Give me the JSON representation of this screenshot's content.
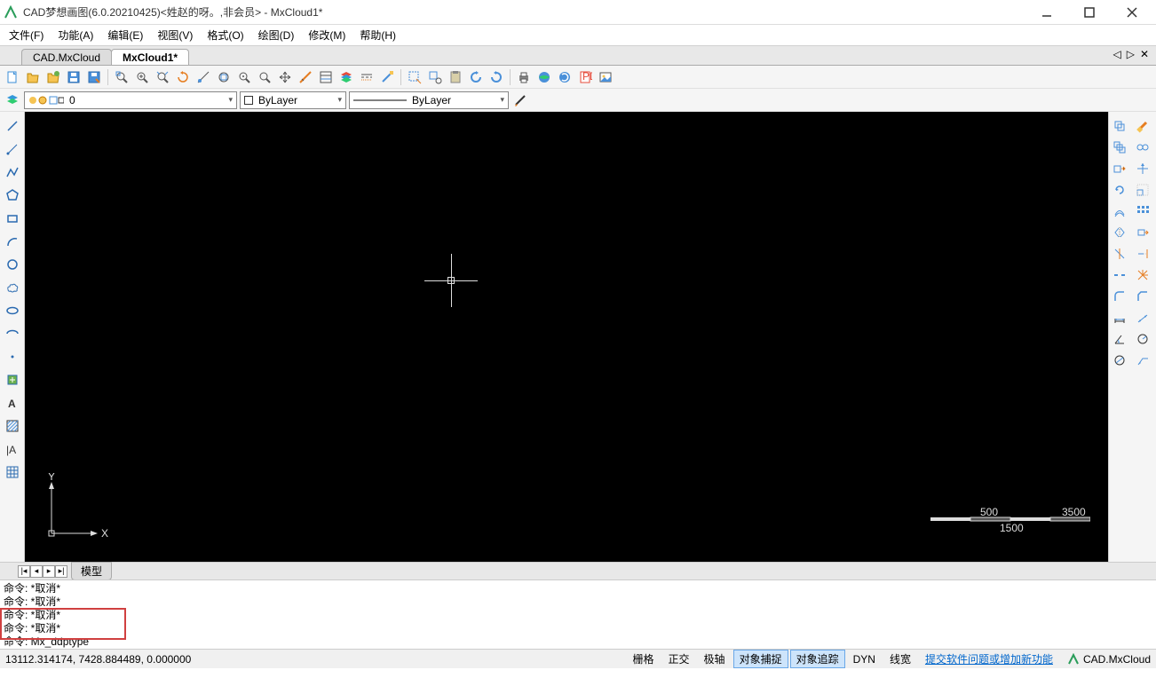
{
  "window": {
    "title": "CAD梦想画图(6.0.20210425)<姓赵的呀。,非会员> - MxCloud1*"
  },
  "menu": {
    "file": "文件(F)",
    "func": "功能(A)",
    "edit": "编辑(E)",
    "view": "视图(V)",
    "format": "格式(O)",
    "draw": "绘图(D)",
    "modify": "修改(M)",
    "help": "帮助(H)"
  },
  "tabs": {
    "t0": "CAD.MxCloud",
    "t1": "MxCloud1*"
  },
  "layer": {
    "current": "0",
    "color_label": "ByLayer",
    "ltype_label": "ByLayer"
  },
  "modeltab": "模型",
  "scale": {
    "a": "500",
    "b": "3500",
    "c": "1500"
  },
  "cmd": {
    "l0": "命令:  *取消*",
    "l1": "命令:  *取消*",
    "l2": "命令:  *取消*",
    "l3": "命令:  *取消*",
    "prompt": "命令: ",
    "input": "Mx_ddptype"
  },
  "status": {
    "coords": "13112.314174,  7428.884489,  0.000000",
    "grid": "栅格",
    "ortho": "正交",
    "polar": "极轴",
    "osnap": "对象捕捉",
    "otrack": "对象追踪",
    "dyn": "DYN",
    "lwt": "线宽",
    "feedback": "提交软件问题或增加新功能",
    "brand": "CAD.MxCloud"
  },
  "axis": {
    "x": "X",
    "y": "Y"
  }
}
